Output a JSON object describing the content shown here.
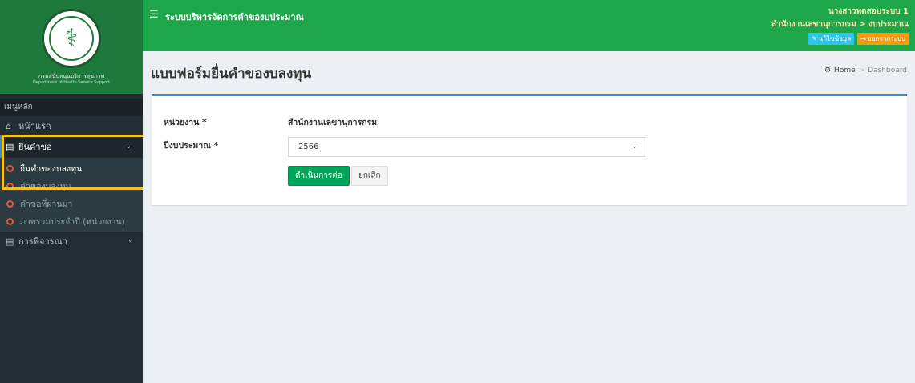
{
  "logo": {
    "caption": "กรมสนับสนุนบริการสุขภาพ",
    "caption_en": "Department of Health Service Support"
  },
  "sidebar": {
    "header": "เมนูหลัก",
    "items": [
      {
        "label": "หน้าแรก",
        "icon": "home-icon"
      },
      {
        "label": "ยื่นคำขอ",
        "icon": "document-icon",
        "expanded": true
      },
      {
        "label": "การพิจารณา",
        "icon": "document-icon",
        "expanded": false
      }
    ],
    "submenu": [
      "ยื่นคำของบลงทุน",
      "คำของบลงทุน",
      "คำขอที่ผ่านมา",
      "ภาพรวมประจำปี (หน่วยงาน)"
    ]
  },
  "topbar": {
    "app_title": "ระบบบริหารจัดการคำของบประมาณ",
    "user": {
      "name": "นางสาวทดสอบระบบ 1",
      "org_line": "สำนักงานเลขานุการกรม > งบประมาณ",
      "edit_label": "แก้ไขข้อมูล",
      "logout_label": "ออกจากระบบ"
    }
  },
  "page": {
    "title": "แบบฟอร์มยื่นคำของบลงทุน",
    "breadcrumb": {
      "home": "Home",
      "current": "Dashboard"
    }
  },
  "form": {
    "unit_label": "หน่วยงาน *",
    "unit_value": "สำนักงานเลขานุการกรม",
    "year_label": "ปีงบประมาณ *",
    "year_value": "2566",
    "submit_label": "ดำเนินการต่อ",
    "cancel_label": "ยกเลิก"
  },
  "colors": {
    "topbar": "#1ea64b",
    "sidebar": "#222d32",
    "highlight": "#f2c123",
    "success": "#00a65a"
  }
}
